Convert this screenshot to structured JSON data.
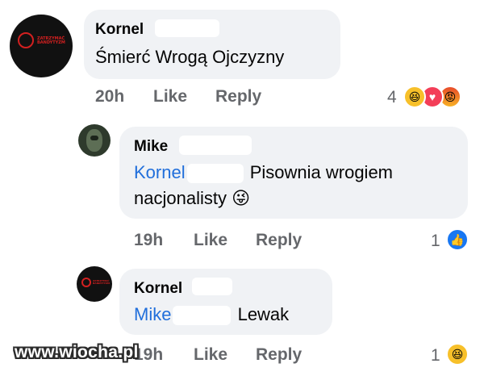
{
  "comments": [
    {
      "author": "Kornel",
      "text": "Śmierć Wrogą Ojczyzny",
      "time": "20h",
      "like": "Like",
      "reply": "Reply",
      "reaction_count": "4",
      "reactions": [
        "haha-icon",
        "love-icon",
        "angry-icon"
      ],
      "avatar_logo": [
        "ZATRZYMAĆ",
        "BANDYTYZM"
      ]
    },
    {
      "author": "Mike",
      "mention": "Kornel",
      "text": "Pisownia wrogiem",
      "text_line2": "nacjonalisty",
      "emoji": "😜",
      "time": "19h",
      "like": "Like",
      "reply": "Reply",
      "reaction_count": "1",
      "reactions": [
        "like-icon"
      ]
    },
    {
      "author": "Kornel",
      "mention": "Mike",
      "text": "Lewak",
      "time": "19h",
      "like": "Like",
      "reply": "Reply",
      "reaction_count": "1",
      "reactions": [
        "haha-icon"
      ],
      "avatar_logo": [
        "ZATRZYMAĆ",
        "BANDYTYZM"
      ]
    }
  ],
  "watermark": "www.wiocha.pl",
  "colors": {
    "bubble": "#f0f2f5",
    "mention": "#216fdb",
    "meta": "#65676b",
    "logo_red": "#d32020"
  }
}
